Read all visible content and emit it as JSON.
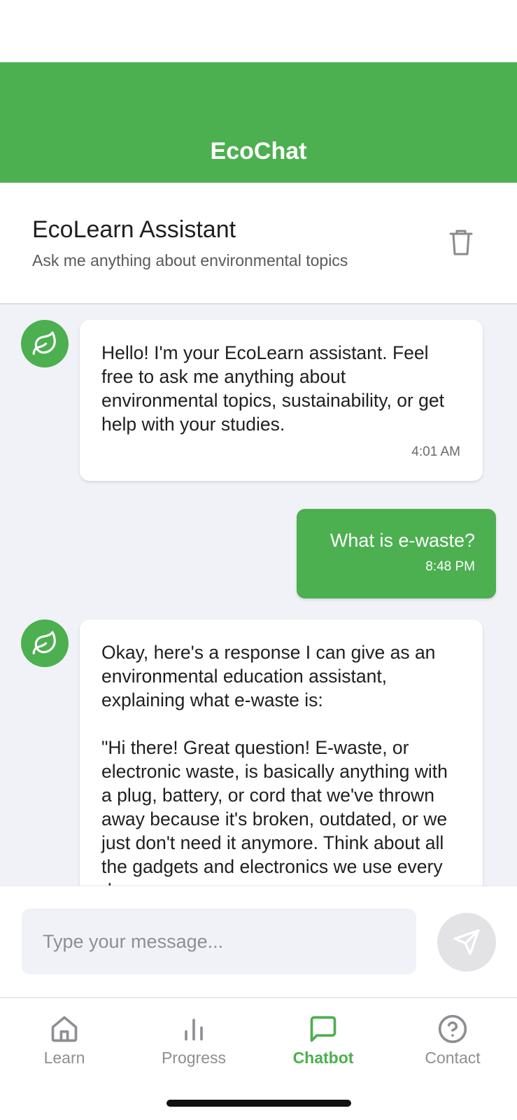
{
  "app": {
    "title": "EcoChat"
  },
  "assistant": {
    "name": "EcoLearn Assistant",
    "subtitle": "Ask me anything about environmental topics"
  },
  "messages": [
    {
      "sender": "bot",
      "text": "Hello! I'm your EcoLearn assistant. Feel free to ask me anything about environmental topics, sustainability, or get help with your studies.",
      "time": "4:01 AM"
    },
    {
      "sender": "user",
      "text": "What is e-waste?",
      "time": "8:48 PM"
    },
    {
      "sender": "bot",
      "text": "Okay, here's a response I can give as an environmental education assistant, explaining what e-waste is:\n\n\"Hi there! Great question! E-waste, or electronic waste, is basically anything with a plug, battery, or cord that we've thrown away because it's broken, outdated, or we just don't need it anymore. Think about all the gadgets and electronics we use every day",
      "time": ""
    }
  ],
  "input": {
    "placeholder": "Type your message..."
  },
  "nav": {
    "items": [
      {
        "label": "Learn",
        "icon": "home-icon",
        "active": false
      },
      {
        "label": "Progress",
        "icon": "bar-chart-icon",
        "active": false
      },
      {
        "label": "Chatbot",
        "icon": "chat-icon",
        "active": true
      },
      {
        "label": "Contact",
        "icon": "help-circle-icon",
        "active": false
      }
    ]
  },
  "colors": {
    "primary": "#4caf50",
    "chat_background": "#f1f2f7",
    "inactive": "#8e8e93"
  }
}
